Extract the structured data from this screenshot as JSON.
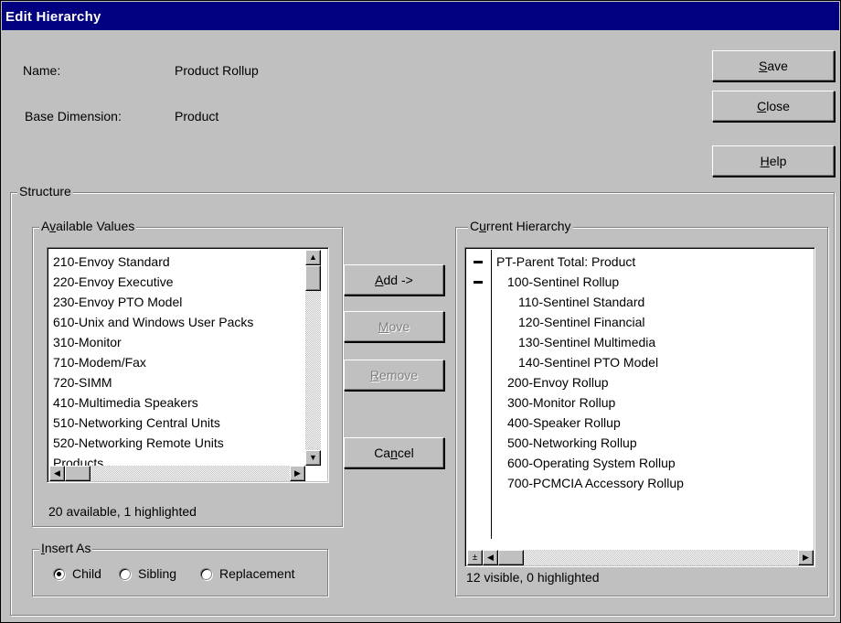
{
  "window": {
    "title": "Edit Hierarchy"
  },
  "fields": {
    "name_label": "Name:",
    "name_value": "Product Rollup",
    "base_label": "Base Dimension:",
    "base_value": "Product"
  },
  "buttons": {
    "save": "Save",
    "close": "Close",
    "help": "Help",
    "add": "Add ->",
    "move": "Move",
    "remove": "Remove",
    "cancel": "Cancel"
  },
  "structure": {
    "label": "Structure",
    "available": {
      "label": "Available Values",
      "items": [
        "210-Envoy Standard",
        "220-Envoy Executive",
        "230-Envoy PTO Model",
        "610-Unix and Windows User Packs",
        "310-Monitor",
        "710-Modem/Fax",
        "720-SIMM",
        "410-Multimedia Speakers",
        "510-Networking Central Units",
        "520-Networking Remote Units",
        "Products"
      ],
      "status": "20 available, 1 highlighted"
    },
    "current": {
      "label": "Current Hierarchy",
      "items": [
        "PT-Parent Total: Product",
        "100-Sentinel Rollup",
        "110-Sentinel Standard",
        "120-Sentinel Financial",
        "130-Sentinel Multimedia",
        "140-Sentinel PTO Model",
        "200-Envoy Rollup",
        "300-Monitor Rollup",
        "400-Speaker Rollup",
        "500-Networking Rollup",
        "600-Operating System Rollup",
        "700-PCMCIA Accessory Rollup"
      ],
      "status": "12 visible, 0 highlighted"
    },
    "insert_as": {
      "label": "Insert As",
      "options": [
        "Child",
        "Sibling",
        "Replacement"
      ],
      "selected": "Child"
    }
  },
  "icons": {
    "collapse": "minus-icon",
    "expand_toggle": "plus-minus-icon",
    "scroll_up": "arrow-up-icon",
    "scroll_down": "arrow-down-icon",
    "scroll_left": "arrow-left-icon",
    "scroll_right": "arrow-right-icon"
  },
  "colors": {
    "titlebar": "#000080",
    "face": "#c0c0c0",
    "list_bg": "#ffffff"
  }
}
